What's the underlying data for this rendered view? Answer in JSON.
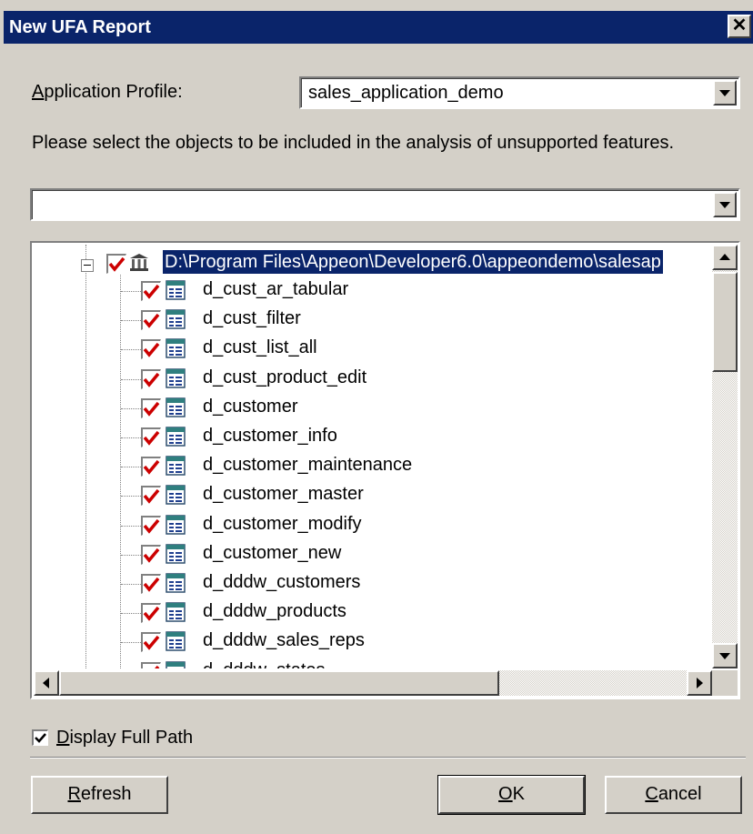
{
  "window": {
    "title": "New UFA Report",
    "close_symbol": "✕"
  },
  "profile": {
    "label": "Application Profile:",
    "label_mnemonic": "A",
    "label_rest": "pplication Profile:",
    "value": "sales_application_demo"
  },
  "instructions": "Please select the objects to be included in the analysis of unsupported features.",
  "filter_combo": {
    "value": ""
  },
  "tree": {
    "root": {
      "label": "D:\\Program Files\\Appeon\\Developer6.0\\appeondemo\\salesap",
      "checked": true,
      "selected": true
    },
    "items": [
      "d_cust_ar_tabular",
      "d_cust_filter",
      "d_cust_list_all",
      "d_cust_product_edit",
      "d_customer",
      "d_customer_info",
      "d_customer_maintenance",
      "d_customer_master",
      "d_customer_modify",
      "d_customer_new",
      "d_dddw_customers",
      "d_dddw_products",
      "d_dddw_sales_reps",
      "d_dddw_states"
    ]
  },
  "display_full_path": {
    "mnemonic": "D",
    "rest": "isplay Full Path",
    "checked": true
  },
  "buttons": {
    "refresh": {
      "mnemonic": "R",
      "rest": "efresh"
    },
    "ok": {
      "mnemonic": "O",
      "rest": "K"
    },
    "cancel": {
      "mnemonic": "C",
      "rest": "ancel"
    }
  },
  "colors": {
    "title_bar": "#0a246a",
    "face": "#d4d0c8",
    "check": "#cc0000",
    "selection": "#0a246a"
  }
}
